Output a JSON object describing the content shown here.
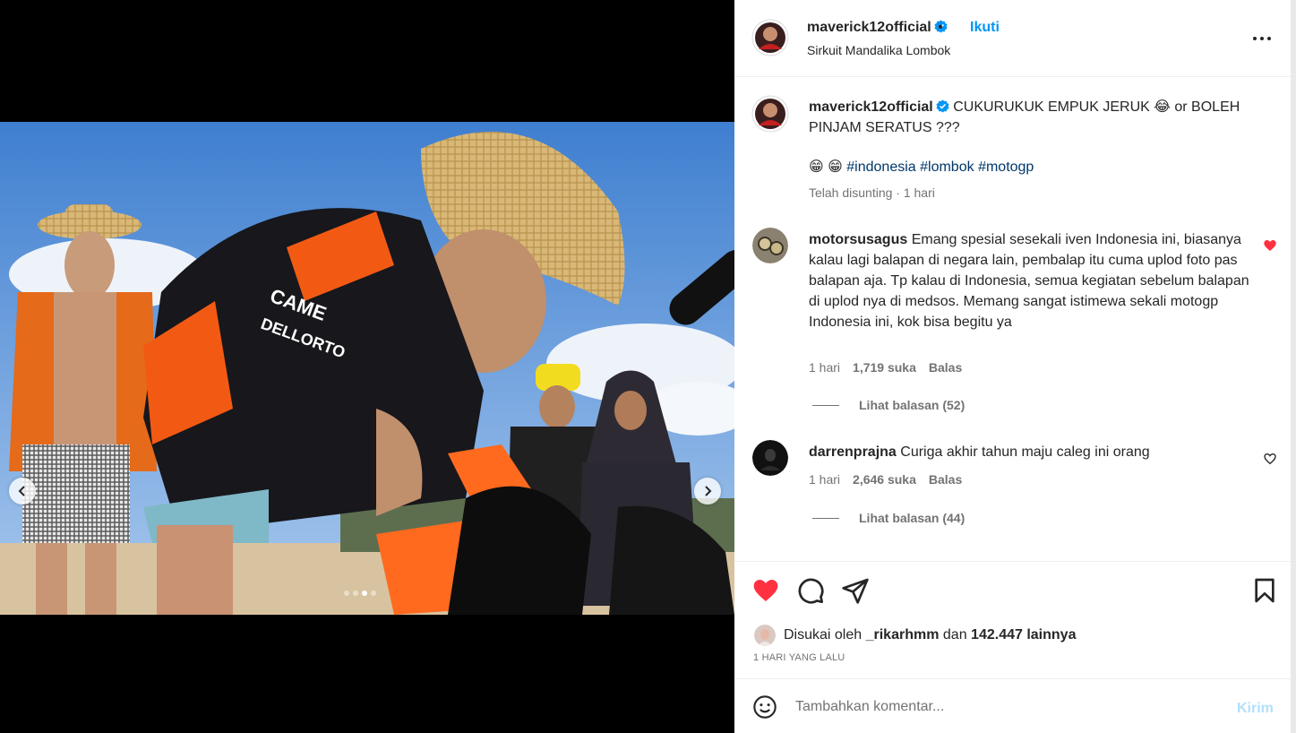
{
  "header": {
    "username": "maverick12official",
    "separator": "•",
    "follow_label": "Ikuti",
    "location": "Sirkuit Mandalika Lombok"
  },
  "caption": {
    "username": "maverick12official",
    "text": "CUKURUKUK EMPUK JERUK 😂 or BOLEH PINJAM SERATUS ???",
    "emojis": "😁 😁",
    "hashtags": [
      "#indonesia",
      "#lombok",
      "#motogp"
    ],
    "meta": "Telah disunting · 1 hari"
  },
  "comments": [
    {
      "username": "motorsusagus",
      "text": "Emang spesial sesekali iven Indonesia ini, biasanya kalau lagi balapan di negara lain, pembalap itu cuma uplod foto pas balapan aja. Tp kalau di Indonesia, semua kegiatan sebelum balapan di uplod nya di medsos. Memang sangat istimewa sekali motogp Indonesia ini, kok bisa begitu ya",
      "time": "1 hari",
      "likes": "1,719 suka",
      "reply_label": "Balas",
      "view_replies": "Lihat balasan (52)",
      "liked": true
    },
    {
      "username": "darrenprajna",
      "text": "Curiga akhir tahun maju caleg ini orang",
      "time": "1 hari",
      "likes": "2,646 suka",
      "reply_label": "Balas",
      "view_replies": "Lihat balasan (44)",
      "liked": false
    }
  ],
  "likes": {
    "prefix": "Disukai oleh",
    "user": "_rikarhmm",
    "conjunction": "dan",
    "count": "142.447 lainnya"
  },
  "timestamp": "1 HARI YANG LALU",
  "comment_box": {
    "placeholder": "Tambahkan komentar...",
    "post_label": "Kirim"
  },
  "carousel": {
    "total": 4,
    "active_index": 2
  },
  "colors": {
    "accent": "#0095f6",
    "like_red": "#ff3040",
    "hashtag": "#00376b",
    "muted": "#737373"
  },
  "icons": [
    "verified-icon",
    "more-options-icon",
    "heart-icon",
    "comment-icon",
    "share-icon",
    "bookmark-icon",
    "emoji-icon",
    "chevron-left-icon",
    "chevron-right-icon"
  ]
}
